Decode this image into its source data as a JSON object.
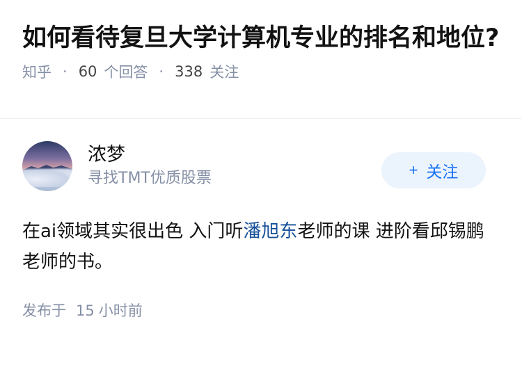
{
  "question": {
    "title": "如何看待复旦大学计算机专业的排名和地位?",
    "source": "知乎",
    "answer_count": "60",
    "answer_label": "个回答",
    "follower_count": "338",
    "follower_label": "关注"
  },
  "answer": {
    "author_name": "浓梦",
    "author_bio": "寻找TMT优质股票",
    "follow_button": {
      "icon": "+",
      "label": "关注"
    },
    "content_before_link": "在ai领域其实很出色 入门听",
    "content_link": "潘旭东",
    "content_after_link": "老师的课 进阶看邱锡鹏老师的书。",
    "time_prefix": "发布于",
    "time_value": "15",
    "time_unit": "小时前"
  },
  "colors": {
    "link": "#175199",
    "accent": "#1772f6",
    "meta": "#8590a6"
  }
}
